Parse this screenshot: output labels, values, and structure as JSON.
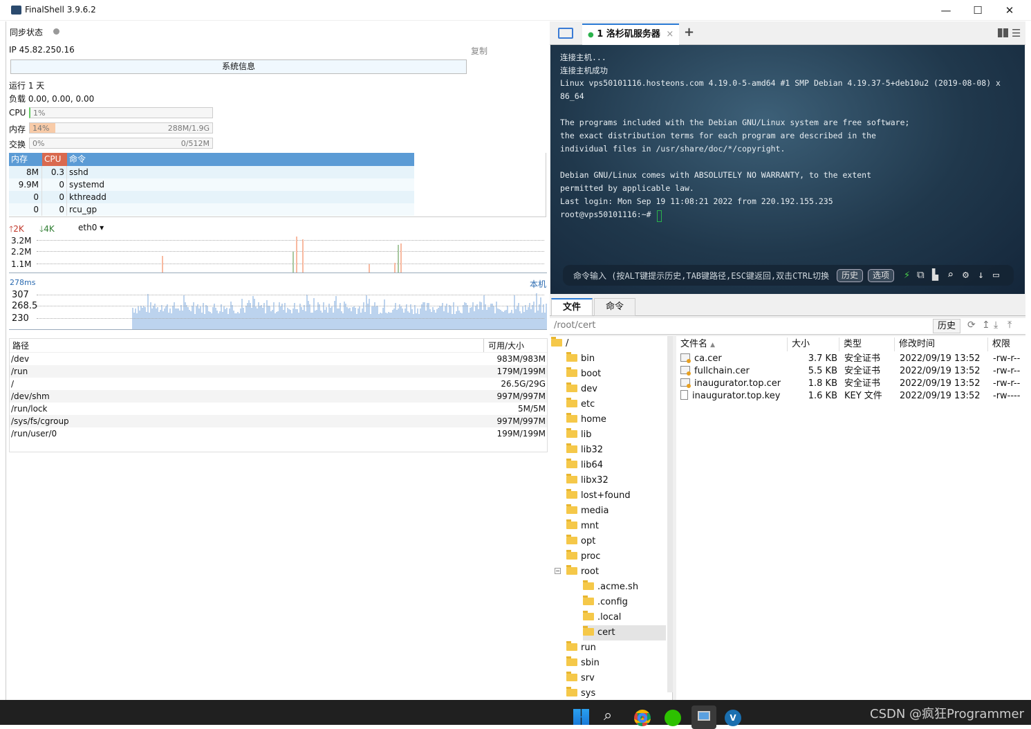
{
  "window": {
    "title": "FinalShell 3.9.6.2",
    "minimize": "—",
    "maximize": "☐",
    "close": "✕"
  },
  "left": {
    "sync_label": "同步状态",
    "ip": "IP 45.82.250.16",
    "copy": "复制",
    "sysinfo_button": "系统信息",
    "uptime": "运行 1 天",
    "load": "负载 0.00, 0.00, 0.00",
    "cpu": {
      "label": "CPU",
      "pct": "1%",
      "fraction": 0.01
    },
    "mem": {
      "label": "内存",
      "pct": "14%",
      "value": "288M/1.9G",
      "fraction": 0.14
    },
    "swap": {
      "label": "交换",
      "pct": "0%",
      "value": "0/512M",
      "fraction": 0
    },
    "proc_headers": [
      "内存",
      "CPU",
      "命令"
    ],
    "processes": [
      [
        "8M",
        "0.3",
        "sshd"
      ],
      [
        "9.9M",
        "0",
        "systemd"
      ],
      [
        "0",
        "0",
        "kthreadd"
      ],
      [
        "0",
        "0",
        "rcu_gp"
      ]
    ],
    "net": {
      "up": "2K",
      "down": "4K",
      "iface": "eth0",
      "ticks": [
        "3.2M",
        "2.2M",
        "1.1M"
      ]
    },
    "ping": {
      "current": "278ms",
      "host": "本机",
      "ticks": [
        "307",
        "268.5",
        "230"
      ]
    },
    "disk_headers": [
      "路径",
      "可用/大小"
    ],
    "disks": [
      [
        "/dev",
        "983M/983M"
      ],
      [
        "/run",
        "179M/199M"
      ],
      [
        "/",
        "26.5G/29G"
      ],
      [
        "/dev/shm",
        "997M/997M"
      ],
      [
        "/run/lock",
        "5M/5M"
      ],
      [
        "/sys/fs/cgroup",
        "997M/997M"
      ],
      [
        "/run/user/0",
        "199M/199M"
      ]
    ]
  },
  "session_tab": {
    "label": "1 洛杉矶服务器",
    "close": "×",
    "add": "+"
  },
  "terminal": {
    "lines": [
      "连接主机...",
      "连接主机成功",
      "Linux vps50101116.hosteons.com 4.19.0-5-amd64 #1 SMP Debian 4.19.37-5+deb10u2 (2019-08-08) x",
      "86_64",
      "",
      "The programs included with the Debian GNU/Linux system are free software;",
      "the exact distribution terms for each program are described in the",
      "individual files in /usr/share/doc/*/copyright.",
      "",
      "Debian GNU/Linux comes with ABSOLUTELY NO WARRANTY, to the extent",
      "permitted by applicable law.",
      "Last login: Mon Sep 19 11:08:21 2022 from 220.192.155.235",
      "root@vps50101116:~# "
    ],
    "cmd_hint": "命令输入 (按ALT键提示历史,TAB键路径,ESC键返回,双击CTRL切换",
    "history": "历史",
    "options": "选项"
  },
  "file_tabs": [
    "文件",
    "命令"
  ],
  "path": "/root/cert",
  "path_history": "历史",
  "tree": [
    {
      "name": "/",
      "level": 0
    },
    {
      "name": "bin",
      "level": 1
    },
    {
      "name": "boot",
      "level": 1
    },
    {
      "name": "dev",
      "level": 1
    },
    {
      "name": "etc",
      "level": 1
    },
    {
      "name": "home",
      "level": 1
    },
    {
      "name": "lib",
      "level": 1
    },
    {
      "name": "lib32",
      "level": 1
    },
    {
      "name": "lib64",
      "level": 1
    },
    {
      "name": "libx32",
      "level": 1
    },
    {
      "name": "lost+found",
      "level": 1
    },
    {
      "name": "media",
      "level": 1
    },
    {
      "name": "mnt",
      "level": 1
    },
    {
      "name": "opt",
      "level": 1
    },
    {
      "name": "proc",
      "level": 1
    },
    {
      "name": "root",
      "level": 1
    },
    {
      "name": ".acme.sh",
      "level": 2
    },
    {
      "name": ".config",
      "level": 2
    },
    {
      "name": ".local",
      "level": 2
    },
    {
      "name": "cert",
      "level": 2,
      "selected": true
    },
    {
      "name": "run",
      "level": 1
    },
    {
      "name": "sbin",
      "level": 1
    },
    {
      "name": "srv",
      "level": 1
    },
    {
      "name": "sys",
      "level": 1
    }
  ],
  "file_headers": [
    "文件名",
    "大小",
    "类型",
    "修改时间",
    "权限"
  ],
  "files": [
    {
      "name": "ca.cer",
      "size": "3.7 KB",
      "type": "安全证书",
      "mtime": "2022/09/19 13:52",
      "perm": "-rw-r--",
      "icon": "certificate"
    },
    {
      "name": "fullchain.cer",
      "size": "5.5 KB",
      "type": "安全证书",
      "mtime": "2022/09/19 13:52",
      "perm": "-rw-r--",
      "icon": "certificate"
    },
    {
      "name": "inaugurator.top.cer",
      "size": "1.8 KB",
      "type": "安全证书",
      "mtime": "2022/09/19 13:52",
      "perm": "-rw-r--",
      "icon": "certificate"
    },
    {
      "name": "inaugurator.top.key",
      "size": "1.6 KB",
      "type": "KEY 文件",
      "mtime": "2022/09/19 13:52",
      "perm": "-rw----",
      "icon": "file"
    }
  ],
  "taskbar": {
    "watermark": "CSDN @疯狂Programmer"
  },
  "colors": {
    "accent": "#5b9bd5",
    "cpu_header": "#d9694f",
    "mem_fill": "#f8cba8",
    "terminal_bg": "#20384c",
    "ping_fill": "#bcd3ee"
  }
}
